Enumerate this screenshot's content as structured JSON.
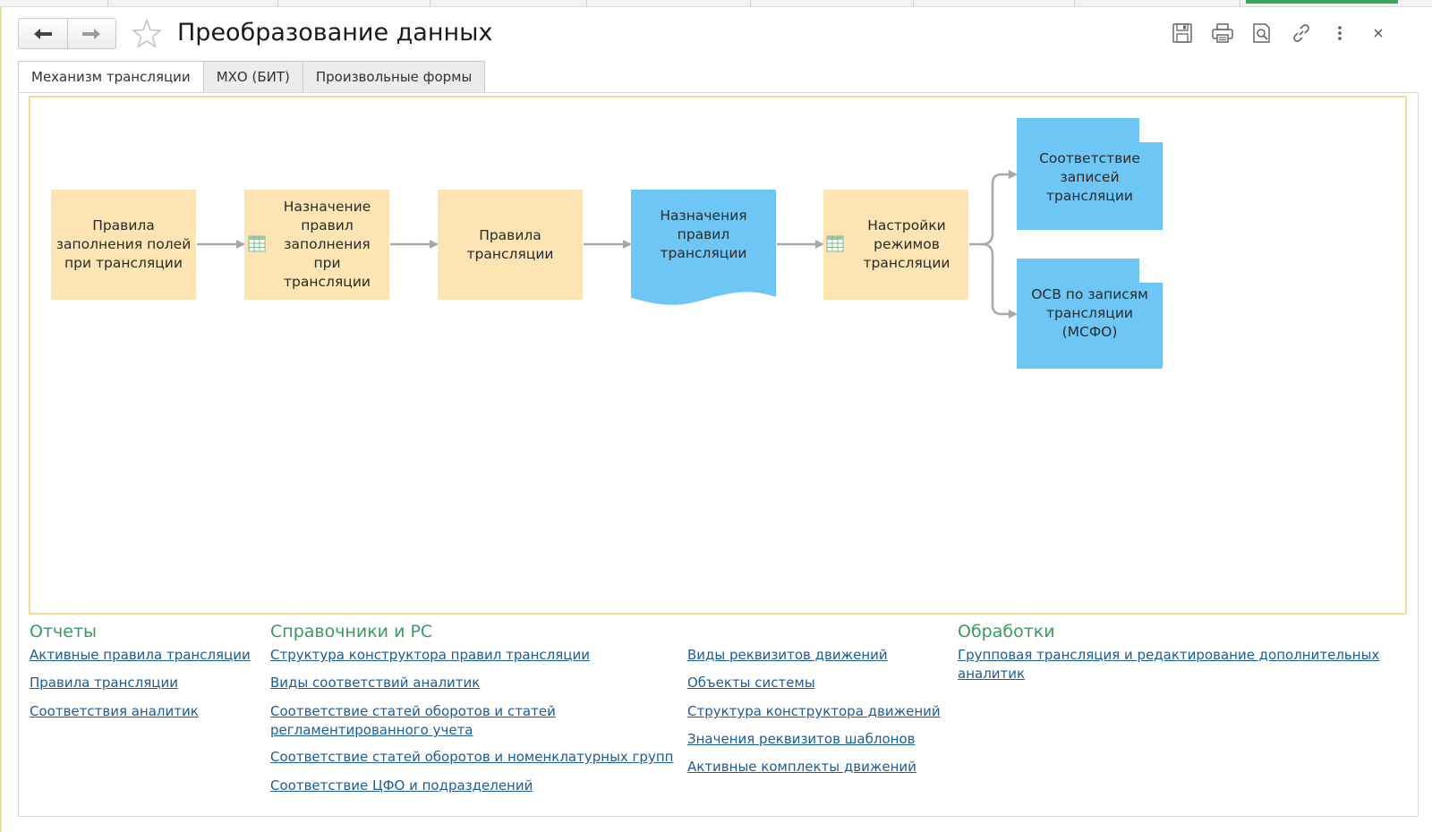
{
  "header": {
    "title": "Преобразование данных"
  },
  "tabs": [
    {
      "label": "Механизм трансляции",
      "active": true
    },
    {
      "label": "МХО (БИТ)",
      "active": false
    },
    {
      "label": "Произвольные формы",
      "active": false
    }
  ],
  "scheme": {
    "boxes": [
      {
        "label": "Правила заполнения полей при трансляции",
        "shape": "rect",
        "color": "#fce4b3"
      },
      {
        "label": "Назначение правил заполнения при трансляции",
        "shape": "rect",
        "color": "#fce4b3",
        "icon": "table-icon"
      },
      {
        "label": "Правила трансляции",
        "shape": "rect",
        "color": "#fce4b3"
      },
      {
        "label": "Назначения правил трансляции",
        "shape": "document",
        "color": "#6ec6f5"
      },
      {
        "label": "Настройки режимов трансляции",
        "shape": "rect",
        "color": "#fce4b3",
        "icon": "table-icon"
      },
      {
        "label": "Соответствие записей трансляции",
        "shape": "sheet",
        "color": "#6ec6f5"
      },
      {
        "label": "ОСВ по записям трансляции (МСФО)",
        "shape": "sheet",
        "color": "#6ec6f5"
      }
    ]
  },
  "sections": {
    "reports": {
      "title": "Отчеты",
      "links": [
        "Активные правила трансляции",
        "Правила трансляции",
        "Соответствия аналитик"
      ]
    },
    "catalogs": {
      "title": "Справочники и РС",
      "links": [
        "Структура конструктора правил трансляции",
        "Виды соответствий аналитик",
        "Соответствие статей оборотов и статей регламентированного учета",
        "Соответствие статей оборотов и номенклатурных групп",
        "Соответствие ЦФО и подразделений"
      ],
      "links2": [
        "Виды реквизитов движений",
        "Объекты системы",
        "Структура конструктора движений",
        "Значения реквизитов шаблонов",
        "Активные комплекты движений"
      ]
    },
    "processing": {
      "title": "Обработки",
      "links": [
        "Групповая трансляция и редактирование дополнительных аналитик"
      ]
    }
  },
  "colors": {
    "accent_green": "#3a9a63",
    "link_blue": "#1c5c97",
    "box_yellow": "#fce4b3",
    "box_blue": "#6ec6f5",
    "frame_yellow": "#f0dd9a"
  }
}
